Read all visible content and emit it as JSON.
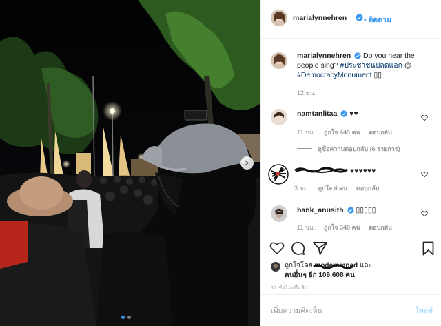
{
  "post": {
    "author": "marialynnehren",
    "follow_label": "• ติดตาม",
    "caption_text": "Do you hear the people sing?",
    "caption_tag1": "#ประชาชนปลดแอก",
    "caption_at": " @",
    "caption_tag2": "#DemocracyMonument",
    "caption_tail": " ▯▯",
    "caption_time": "12 ชม.",
    "likes_prefix": "ถูกใจโดย",
    "likes_redacted_user": "moderemped",
    "likes_and": "และ",
    "likes_others": "คนอื่นๆ อีก 109,608 คน",
    "timestamp": "12 ชั่วโมงที่แล้ว",
    "comment_placeholder": "เพิ่มความคิดเห็น",
    "post_label": "โพสต์"
  },
  "comments": [
    {
      "user": "namtanlitaa",
      "text": "♥♥",
      "time": "11 ชม.",
      "likes": "ถูกใจ 445 คน",
      "reply": "ตอบกลับ",
      "view_replies": "ดูข้อความตอบกลับ (6 รายการ)"
    },
    {
      "user_redacted": "scribbled-username",
      "text": "♥♥♥♥♥♥",
      "time": "3 ชม.",
      "likes": "ถูกใจ 4 คน",
      "reply": "ตอบกลับ"
    },
    {
      "user": "bank_anusith",
      "text": "▯▯▯▯▯",
      "time": "11 ชม.",
      "likes": "ถูกใจ 349 คน",
      "reply": "ตอบกลับ"
    }
  ],
  "icons": {
    "verified": "verified-badge-icon",
    "like": "heart-icon",
    "comment": "comment-bubble-icon",
    "share": "paper-plane-icon",
    "save": "bookmark-icon",
    "next": "chevron-right-icon"
  },
  "colors": {
    "link_blue": "#3897f0",
    "hashtag": "#003569",
    "meta_gray": "#999999",
    "post_disabled": "#b2dffc"
  },
  "carousel": {
    "slide_count": 2,
    "current": 1
  }
}
